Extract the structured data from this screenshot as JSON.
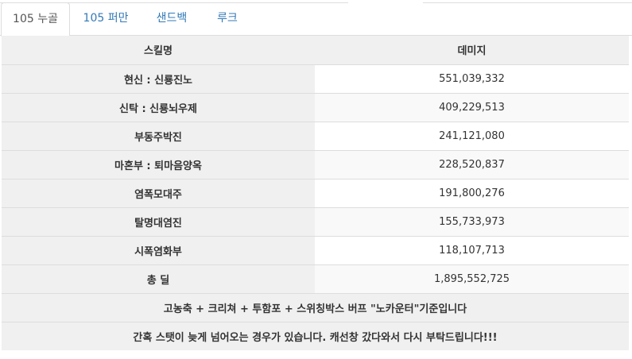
{
  "tabs": [
    {
      "label": "105 누골",
      "active": true
    },
    {
      "label": "105 퍼만",
      "active": false
    },
    {
      "label": "샌드백",
      "active": false
    },
    {
      "label": "루크",
      "active": false
    }
  ],
  "table": {
    "headers": [
      "스킬명",
      "데미지"
    ],
    "rows": [
      {
        "name": "현신 : 신룡진노",
        "damage": "551,039,332"
      },
      {
        "name": "신탁 : 신룡뇌우제",
        "damage": "409,229,513"
      },
      {
        "name": "부동주박진",
        "damage": "241,121,080"
      },
      {
        "name": "마혼부 : 퇴마음양옥",
        "damage": "228,520,837"
      },
      {
        "name": "염폭모대주",
        "damage": "191,800,276"
      },
      {
        "name": "탈명대염진",
        "damage": "155,733,973"
      },
      {
        "name": "시폭염화부",
        "damage": "118,107,713"
      }
    ],
    "total": {
      "name": "총 딜",
      "damage": "1,895,552,725"
    },
    "notes": [
      "고농축 + 크리쳐 + 투함포 + 스위칭박스 버프 \"노카운터\"기준입니다",
      "간혹 스탯이 늦게 넘어오는 경우가 있습니다. 캐선창 갔다와서 다시 부탁드립니다!!!"
    ]
  }
}
